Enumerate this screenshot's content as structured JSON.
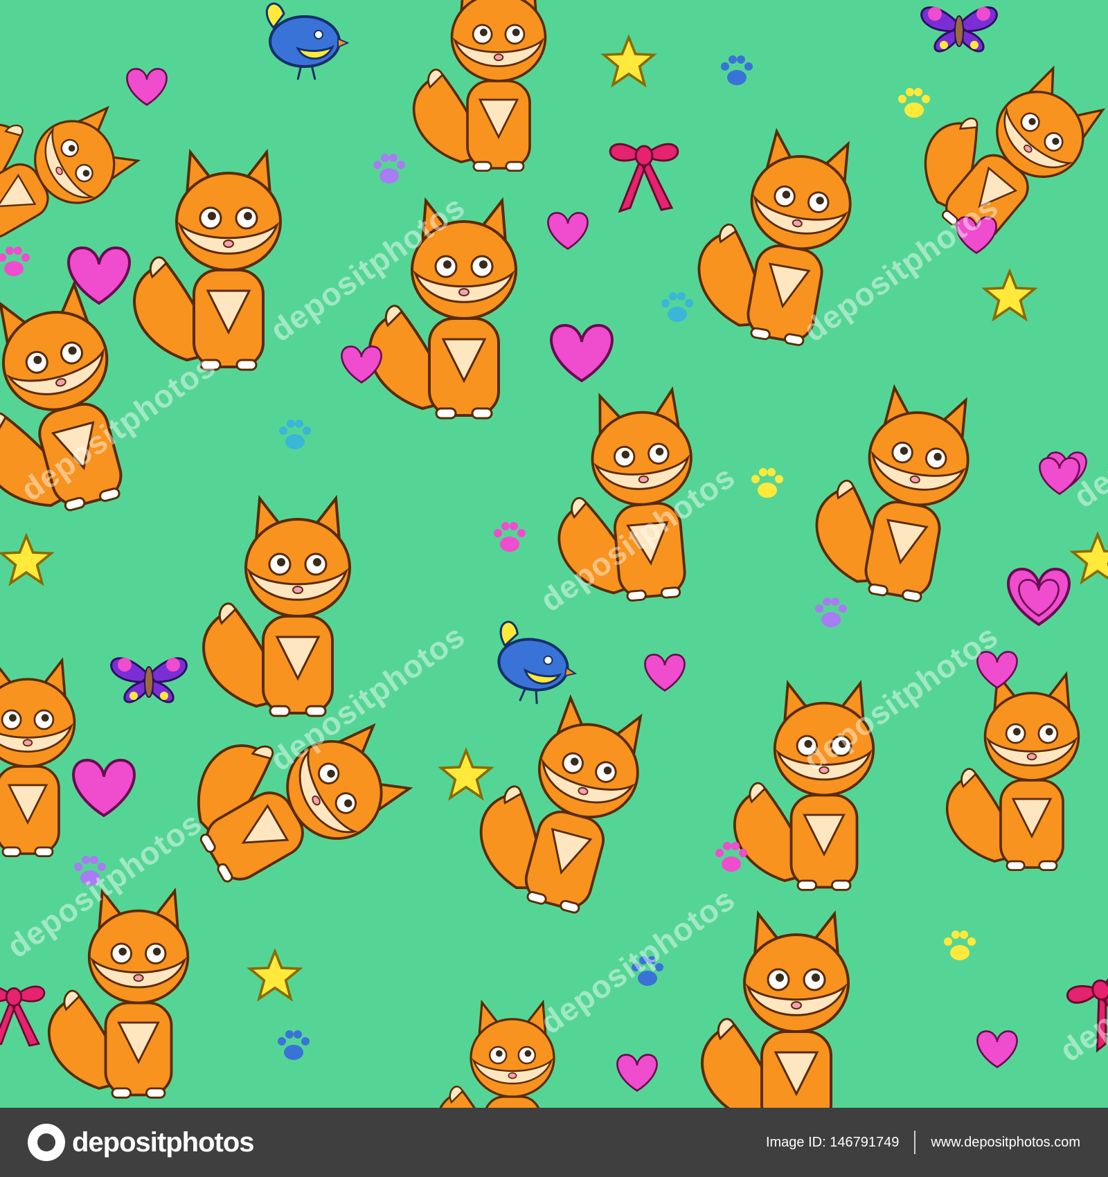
{
  "pattern": {
    "background_color": "#55d595",
    "watermark_text": "depositphotos",
    "motifs": [
      "fox",
      "bird",
      "butterfly",
      "bow",
      "heart",
      "star",
      "paw-print"
    ],
    "palette": {
      "fox_orange": "#f7931e",
      "fox_coral": "#f68b6a",
      "fox_cream": "#fde6c0",
      "heart_pink": "#f04cce",
      "star_yellow": "#ffe93b",
      "bird_blue": "#3a73d8",
      "bow_red": "#e5236f",
      "butterfly_purple": "#7a2fd6"
    }
  },
  "footer": {
    "brand": "depositphotos",
    "image_id": "Image ID: 146791749",
    "site_url": "www.depositphotos.com"
  }
}
